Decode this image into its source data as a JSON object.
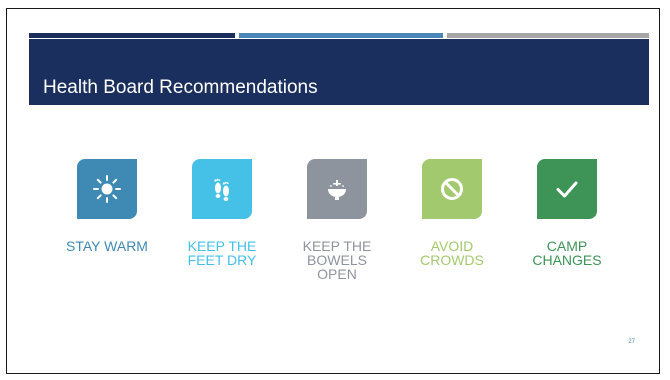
{
  "slide": {
    "title": "Health Board Recommendations",
    "page_number": "27"
  },
  "items": [
    {
      "icon": "sun-icon",
      "color": "#3f8ab4",
      "label_color": "#3f8ab4",
      "label_lines": [
        "STAY WARM"
      ]
    },
    {
      "icon": "footprints-icon",
      "color": "#45c1e8",
      "label_color": "#45c1e8",
      "label_lines": [
        "KEEP THE",
        "FEET DRY"
      ]
    },
    {
      "icon": "toilet-icon",
      "color": "#8e949e",
      "label_color": "#8e949e",
      "label_lines": [
        "KEEP THE",
        "BOWELS",
        "OPEN"
      ]
    },
    {
      "icon": "prohibited-icon",
      "color": "#a3c96e",
      "label_color": "#a3c96e",
      "label_lines": [
        "AVOID",
        "CROWDS"
      ]
    },
    {
      "icon": "checkmark-icon",
      "color": "#3e9456",
      "label_color": "#3e9456",
      "label_lines": [
        "CAMP",
        "CHANGES"
      ]
    }
  ],
  "colors": {
    "title_bar": "#1b2f5e",
    "stripe_left": "#1b2f5e",
    "stripe_middle": "#4a86b8",
    "stripe_right": "#a6a6a6"
  }
}
